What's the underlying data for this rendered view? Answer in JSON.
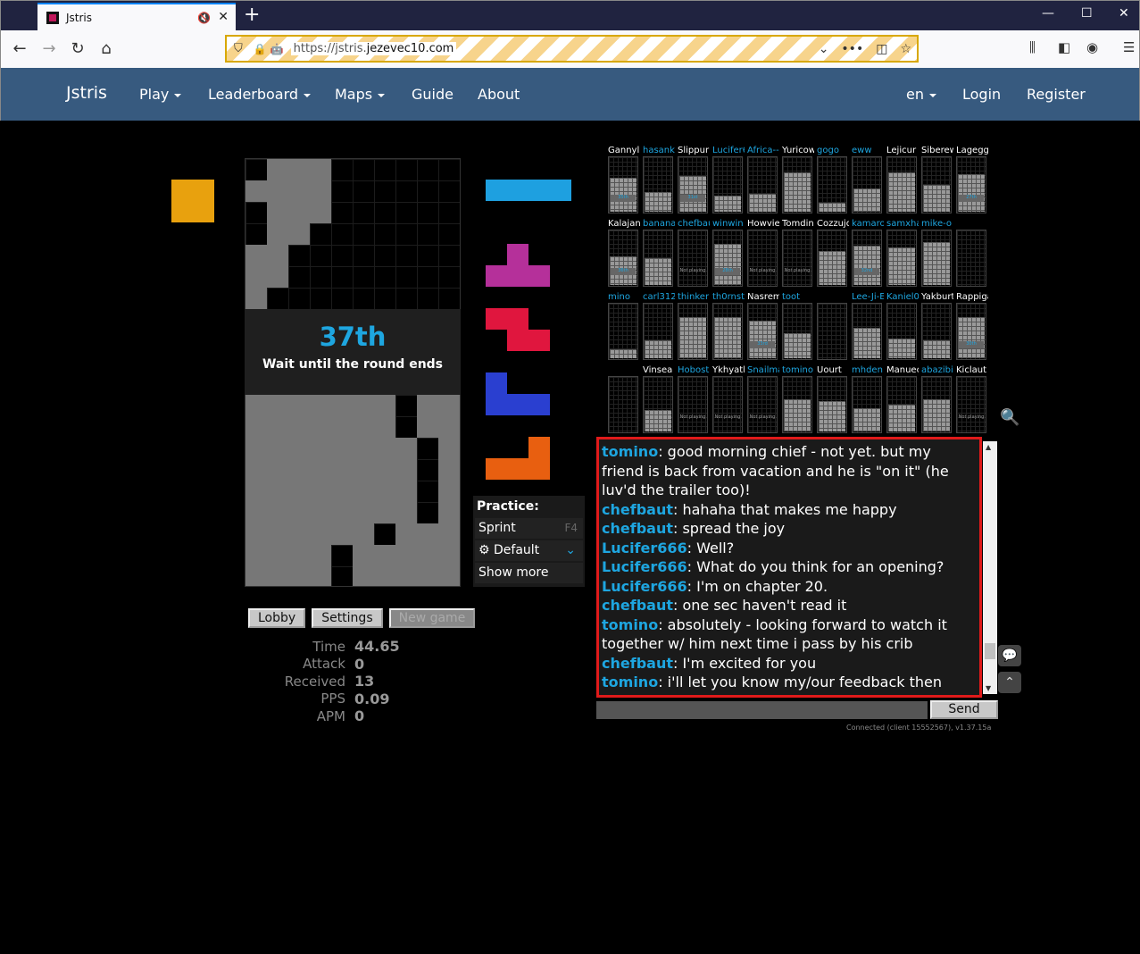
{
  "browser": {
    "tab_title": "Jstris",
    "url_prefix": "https://jstris.",
    "url_domain": "jezevec10.com"
  },
  "site_nav": {
    "brand": "Jstris",
    "items": [
      "Play",
      "Leaderboard",
      "Maps",
      "Guide",
      "About"
    ],
    "right": {
      "language": "en",
      "login": "Login",
      "register": "Register"
    }
  },
  "game": {
    "hold_color": "#e8a10e",
    "placement": "37th",
    "status": "Wait until the round ends",
    "queue": [
      {
        "piece": "I",
        "color": "#1ea0e0"
      },
      {
        "piece": "T",
        "color": "#b5309a"
      },
      {
        "piece": "Z",
        "color": "#e0163e"
      },
      {
        "piece": "J",
        "color": "#2a3fd0"
      },
      {
        "piece": "L",
        "color": "#e85f10"
      }
    ],
    "buttons": {
      "lobby": "Lobby",
      "settings": "Settings",
      "new_game": "New game"
    },
    "stats": [
      {
        "label": "Time",
        "value": "44.65"
      },
      {
        "label": "Attack",
        "value": "0"
      },
      {
        "label": "Received",
        "value": "13"
      },
      {
        "label": "PPS",
        "value": "0.09"
      },
      {
        "label": "APM",
        "value": "0"
      }
    ]
  },
  "practice": {
    "header": "Practice:",
    "sprint": "Sprint",
    "sprint_key": "F4",
    "default": "Default",
    "show_more": "Show more"
  },
  "spectators": [
    {
      "name": "Gannyli",
      "blue": false,
      "rank": "35th"
    },
    {
      "name": "hasanka",
      "blue": true
    },
    {
      "name": "Slippur",
      "blue": false,
      "rank": "31st"
    },
    {
      "name": "Lucifer6",
      "blue": true
    },
    {
      "name": "Africa--",
      "blue": true
    },
    {
      "name": "Yuricow",
      "blue": false
    },
    {
      "name": "gogo",
      "blue": true
    },
    {
      "name": "eww",
      "blue": true
    },
    {
      "name": "Lejicur",
      "blue": false
    },
    {
      "name": "Siberew",
      "blue": false
    },
    {
      "name": "Lageggy",
      "blue": false,
      "rank": "27th"
    },
    {
      "name": "Kalajan",
      "blue": false,
      "rank": "36th"
    },
    {
      "name": "banana",
      "blue": true
    },
    {
      "name": "chefbau",
      "blue": true,
      "np": "Not playing"
    },
    {
      "name": "winwin",
      "blue": true,
      "rank": "28th"
    },
    {
      "name": "Howvie",
      "blue": false,
      "np": "Not playing"
    },
    {
      "name": "Tomdin",
      "blue": false,
      "np": "Not playing"
    },
    {
      "name": "Cozzujo",
      "blue": false
    },
    {
      "name": "kamaro",
      "blue": true,
      "rank": "32nd"
    },
    {
      "name": "samxha",
      "blue": true
    },
    {
      "name": "mike-o",
      "blue": true
    },
    {
      "name": "",
      "blue": false
    },
    {
      "name": "mino",
      "blue": true
    },
    {
      "name": "carl312",
      "blue": true
    },
    {
      "name": "thinker",
      "blue": true
    },
    {
      "name": "th0rnst",
      "blue": true
    },
    {
      "name": "Nasrem",
      "blue": false,
      "rank": "33rd"
    },
    {
      "name": "toot",
      "blue": true
    },
    {
      "name": "",
      "blue": false
    },
    {
      "name": "Lee-Ji-E",
      "blue": true
    },
    {
      "name": "Kaniel0",
      "blue": true
    },
    {
      "name": "Yakburt",
      "blue": false
    },
    {
      "name": "Rappiga",
      "blue": false,
      "rank": "30th"
    },
    {
      "name": "",
      "blue": false
    },
    {
      "name": "Vinsea",
      "blue": false
    },
    {
      "name": "Hobost",
      "blue": true,
      "np": "Not playing"
    },
    {
      "name": "Ykhyath",
      "blue": false,
      "np": "Not playing"
    },
    {
      "name": "Snailma",
      "blue": true,
      "np": "Not playing"
    },
    {
      "name": "tomino",
      "blue": true
    },
    {
      "name": "Uourt",
      "blue": false
    },
    {
      "name": "mhden",
      "blue": true
    },
    {
      "name": "Manuec",
      "blue": false
    },
    {
      "name": "abazibi",
      "blue": true
    },
    {
      "name": "Kiclaut",
      "blue": false,
      "np": "Not playing"
    }
  ],
  "chat": {
    "messages": [
      {
        "user": "tomino",
        "text": " good morning chief - not yet. but my friend is back from vacation and he is \"on it\" (he luv'd the trailer too)!"
      },
      {
        "user": "chefbaut",
        "text": " hahaha that makes me happy"
      },
      {
        "user": "chefbaut",
        "text": " spread the joy"
      },
      {
        "user": "Lucifer666",
        "text": " Well?"
      },
      {
        "user": "Lucifer666",
        "text": " What do you think for an opening?"
      },
      {
        "user": "Lucifer666",
        "text": " I'm on chapter 20."
      },
      {
        "user": "chefbaut",
        "text": " one sec haven't read it"
      },
      {
        "user": "tomino",
        "text": " absolutely - looking forward to watch it together w/ him next time i pass by his crib"
      },
      {
        "user": "chefbaut",
        "text": " I'm excited for you"
      },
      {
        "user": "tomino",
        "text": " i'll let you know my/our feedback then"
      }
    ],
    "send": "Send",
    "connection": "Connected (client 15552567), v1.37.15a"
  }
}
